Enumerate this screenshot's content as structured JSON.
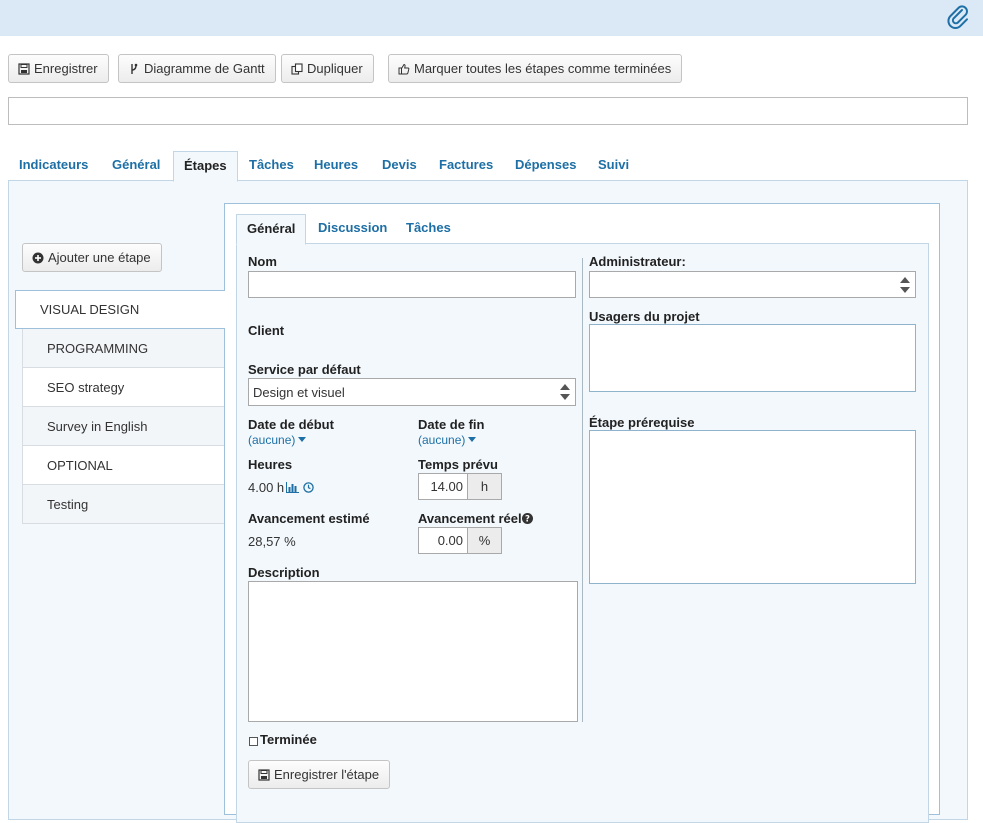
{
  "icons": {
    "attachment": "paperclip-icon",
    "save": "floppy-disk-icon",
    "gantt": "branch-icon",
    "duplicate": "copy-icon",
    "mark_done": "thumbs-up-icon",
    "add": "plus-circle-icon",
    "chart": "bar-chart-icon",
    "clock": "clock-icon",
    "help": "question-circle-icon"
  },
  "colors": {
    "accent": "#1d6fa5",
    "topbar": "#dbe9f7",
    "panel": "#f3f8fc"
  },
  "toolbar": {
    "save_label": "Enregistrer",
    "gantt_label": "Diagramme de Gantt",
    "duplicate_label": "Dupliquer",
    "mark_all_label": "Marquer toutes les étapes comme terminées"
  },
  "subject": {
    "value": ""
  },
  "main_tabs": [
    {
      "label": "Indicateurs"
    },
    {
      "label": "Général"
    },
    {
      "label": "Étapes",
      "active": true
    },
    {
      "label": "Tâches"
    },
    {
      "label": "Heures"
    },
    {
      "label": "Devis"
    },
    {
      "label": "Factures"
    },
    {
      "label": "Dépenses"
    },
    {
      "label": "Suivi"
    }
  ],
  "steps": {
    "add_label": "Ajouter une étape",
    "items": [
      {
        "label": "VISUAL DESIGN",
        "active": true
      },
      {
        "label": "PROGRAMMING"
      },
      {
        "label": "SEO strategy"
      },
      {
        "label": "Survey in English"
      },
      {
        "label": "OPTIONAL"
      },
      {
        "label": "Testing"
      }
    ]
  },
  "detail_tabs": [
    {
      "label": "Général",
      "active": true
    },
    {
      "label": "Discussion"
    },
    {
      "label": "Tâches"
    }
  ],
  "form": {
    "nom_label": "Nom",
    "nom_value": "",
    "client_label": "Client",
    "service_label": "Service par défaut",
    "service_value": "Design et visuel",
    "date_debut_label": "Date de début",
    "date_debut_value": "(aucune)",
    "date_fin_label": "Date de fin",
    "date_fin_value": "(aucune)",
    "heures_label": "Heures",
    "heures_value": "4.00 h",
    "temps_prevu_label": "Temps prévu",
    "temps_prevu_value": "14.00",
    "temps_prevu_unit": "h",
    "avancement_estime_label": "Avancement estimé",
    "avancement_estime_value": "28,57 %",
    "avancement_reel_label": "Avancement réel",
    "avancement_reel_value": "0.00",
    "avancement_reel_unit": "%",
    "description_label": "Description",
    "description_value": "",
    "terminee_label": "Terminée",
    "terminee_checked": false,
    "save_step_label": "Enregistrer l'étape",
    "administrateur_label": "Administrateur:",
    "administrateur_value": "",
    "usagers_label": "Usagers du projet",
    "prerequise_label": "Étape prérequise"
  }
}
